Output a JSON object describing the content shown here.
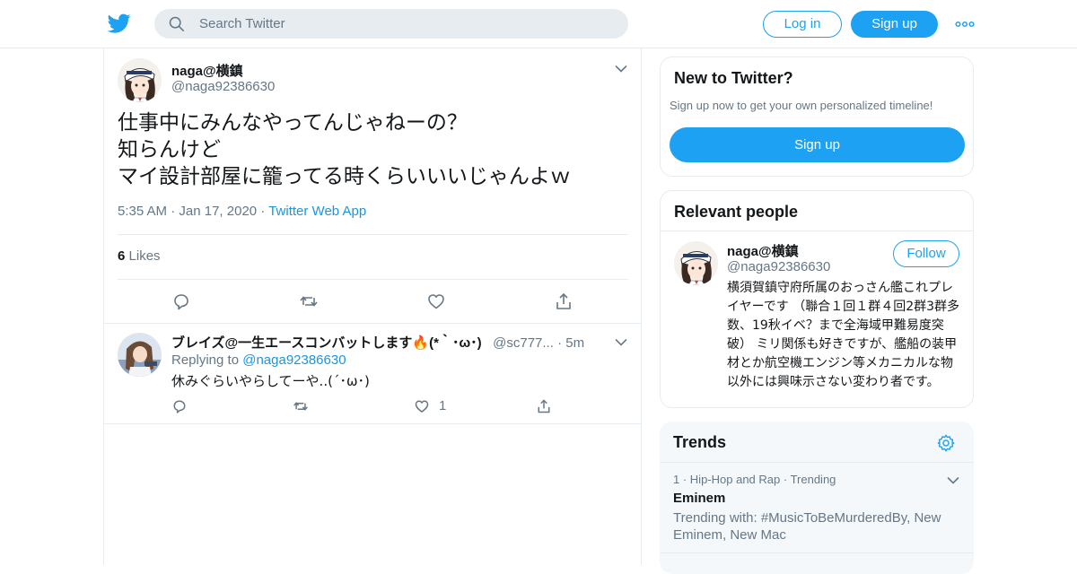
{
  "header": {
    "search_placeholder": "Search Twitter",
    "login_label": "Log in",
    "signup_label": "Sign up"
  },
  "tweet": {
    "author_name": "naga@横鎮",
    "author_handle": "@naga92386630",
    "text_lines": [
      "仕事中にみんなやってんじゃねーの？",
      "知らんけど",
      "マイ設計部屋に籠ってる時くらいいいじゃんよｗ"
    ],
    "time": "5:35 AM",
    "date": "Jan 17, 2020",
    "source": "Twitter Web App",
    "likes_count": "6",
    "likes_label": "Likes"
  },
  "reply": {
    "author_name": "ブレイズ@一生エースコンバットします🔥(*｀･ω･)",
    "author_handle": "@sc777...",
    "time": "5m",
    "replying_to_label": "Replying to",
    "replying_to_handle": "@naga92386630",
    "text": "休みぐらいやらしてーや..(´･ω･)",
    "like_count": "1"
  },
  "new_to_twitter": {
    "title": "New to Twitter?",
    "subtitle": "Sign up now to get your own personalized timeline!",
    "signup_label": "Sign up"
  },
  "relevant_people": {
    "title": "Relevant people",
    "name": "naga@横鎮",
    "handle": "@naga92386630",
    "follow_label": "Follow",
    "bio": "横須賀鎮守府所属のおっさん艦これプレイヤーです （聯合１回１群４回2群3群多数、19秋イベ？まで全海域甲難易度突破） ミリ関係も好きですが、艦船の装甲材とか航空機エンジン等メカニカルな物以外には興味示さない変わり者です。"
  },
  "trends": {
    "title": "Trends",
    "items": [
      {
        "rank": "1",
        "category": "Hip-Hop and Rap",
        "status": "Trending",
        "name": "Eminem",
        "trending_with": "Trending with: #MusicToBeMurderedBy, New Eminem, New Mac"
      }
    ]
  },
  "colors": {
    "brand_blue": "#1da1f2",
    "link_blue": "#1b95e0",
    "secondary_text": "#657786",
    "border": "#e6ecf0"
  }
}
